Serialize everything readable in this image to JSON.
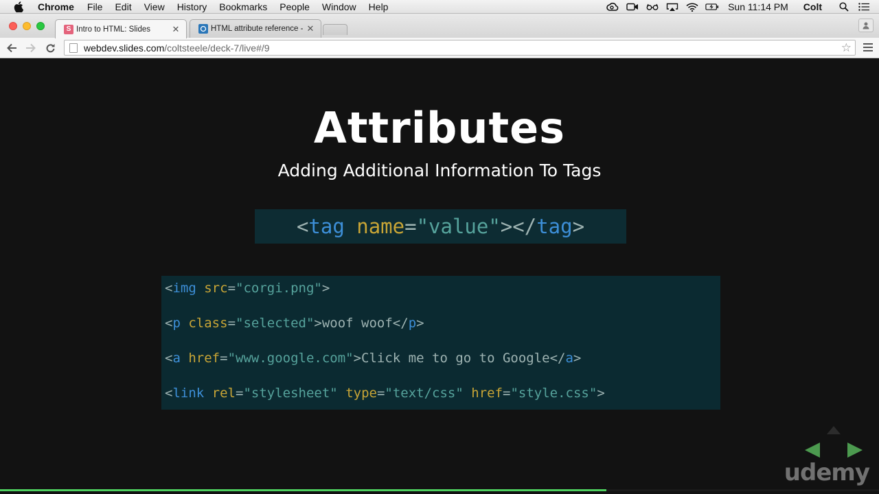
{
  "menubar": {
    "app_name": "Chrome",
    "items": [
      "File",
      "Edit",
      "View",
      "History",
      "Bookmarks",
      "People",
      "Window",
      "Help"
    ],
    "clock": "Sun 11:14 PM",
    "user": "Colt",
    "status_icons": [
      "creative-cloud-icon",
      "facetime-icon",
      "glasses-icon",
      "airplay-icon",
      "wifi-icon",
      "battery-icon",
      "search-icon",
      "list-icon"
    ]
  },
  "tabs": [
    {
      "title": "Intro to HTML: Slides",
      "favicon": "slides-icon",
      "active": true
    },
    {
      "title": "HTML attribute reference -",
      "favicon": "mdn-icon",
      "active": false
    }
  ],
  "toolbar": {
    "url_host": "webdev.slides.com",
    "url_path": "/coltsteele/deck-7/live#/9"
  },
  "slide": {
    "title": "Attributes",
    "subtitle": "Adding Additional Information To Tags",
    "syntax": [
      {
        "t": "<",
        "c": "punct"
      },
      {
        "t": "tag",
        "c": "tag"
      },
      {
        "t": " ",
        "c": "text"
      },
      {
        "t": "name",
        "c": "attr"
      },
      {
        "t": "=",
        "c": "punct"
      },
      {
        "t": "\"value\"",
        "c": "str"
      },
      {
        "t": "></",
        "c": "punct"
      },
      {
        "t": "tag",
        "c": "tag"
      },
      {
        "t": ">",
        "c": "punct"
      }
    ],
    "code_lines": [
      [
        {
          "t": "<",
          "c": "punct"
        },
        {
          "t": "img",
          "c": "tag"
        },
        {
          "t": " ",
          "c": "text"
        },
        {
          "t": "src",
          "c": "attr"
        },
        {
          "t": "=",
          "c": "punct"
        },
        {
          "t": "\"corgi.png\"",
          "c": "str"
        },
        {
          "t": ">",
          "c": "punct"
        }
      ],
      [
        {
          "t": "<",
          "c": "punct"
        },
        {
          "t": "p",
          "c": "tag"
        },
        {
          "t": " ",
          "c": "text"
        },
        {
          "t": "class",
          "c": "attr"
        },
        {
          "t": "=",
          "c": "punct"
        },
        {
          "t": "\"selected\"",
          "c": "str"
        },
        {
          "t": ">woof woof</",
          "c": "text"
        },
        {
          "t": "p",
          "c": "tag"
        },
        {
          "t": ">",
          "c": "punct"
        }
      ],
      [
        {
          "t": "<",
          "c": "punct"
        },
        {
          "t": "a",
          "c": "tag"
        },
        {
          "t": " ",
          "c": "text"
        },
        {
          "t": "href",
          "c": "attr"
        },
        {
          "t": "=",
          "c": "punct"
        },
        {
          "t": "\"www.google.com\"",
          "c": "str"
        },
        {
          "t": ">Click me to go to Google</",
          "c": "text"
        },
        {
          "t": "a",
          "c": "tag"
        },
        {
          "t": ">",
          "c": "punct"
        }
      ],
      [
        {
          "t": "<",
          "c": "punct"
        },
        {
          "t": "link",
          "c": "tag"
        },
        {
          "t": " ",
          "c": "text"
        },
        {
          "t": "rel",
          "c": "attr"
        },
        {
          "t": "=",
          "c": "punct"
        },
        {
          "t": "\"stylesheet\"",
          "c": "str"
        },
        {
          "t": " ",
          "c": "text"
        },
        {
          "t": "type",
          "c": "attr"
        },
        {
          "t": "=",
          "c": "punct"
        },
        {
          "t": "\"text/css\"",
          "c": "str"
        },
        {
          "t": " ",
          "c": "text"
        },
        {
          "t": "href",
          "c": "attr"
        },
        {
          "t": "=",
          "c": "punct"
        },
        {
          "t": "\"style.css\"",
          "c": "str"
        },
        {
          "t": ">",
          "c": "punct"
        }
      ]
    ],
    "syntax_colors": {
      "punct": "#9eb3b2",
      "tag": "#3d8fd8",
      "attr": "#c8a536",
      "str": "#56a39c",
      "text": "#9eb3b2"
    },
    "logo": "udemy",
    "progress": 0.69,
    "accent_color": "#4fd05f"
  }
}
